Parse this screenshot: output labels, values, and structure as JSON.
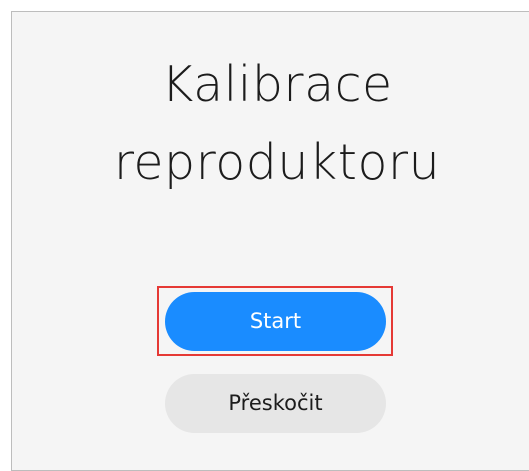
{
  "title": {
    "line1": "Kalibrace",
    "line2": "reproduktoru"
  },
  "buttons": {
    "start_label": "Start",
    "skip_label": "Přeskočit"
  },
  "colors": {
    "primary": "#1a8cff",
    "secondary": "#e6e6e6",
    "highlight": "#e53935",
    "background": "#f5f5f5"
  }
}
